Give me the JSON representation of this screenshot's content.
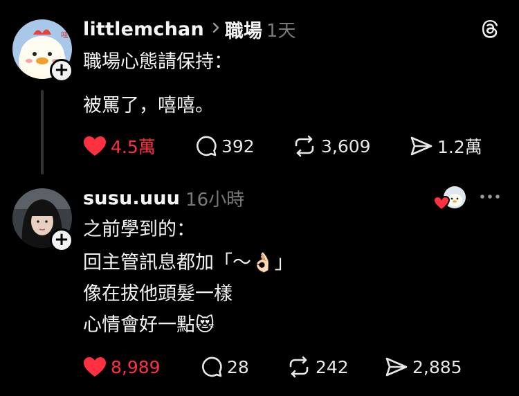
{
  "post": {
    "username": "littlemchan",
    "topic": "職場",
    "time": "1天",
    "lines": [
      "職場心態請保持：",
      "被罵了，嘻嘻。"
    ],
    "actions": {
      "likes": "4.5萬",
      "comments": "392",
      "reposts": "3,609",
      "shares": "1.2萬"
    }
  },
  "reply": {
    "username": "susu.uuu",
    "time": "16小時",
    "lines": [
      "之前學到的：",
      "回主管訊息都加「～👌🏻」",
      "像在拔他頭髮一樣",
      "心情會好一點😻"
    ],
    "actions": {
      "likes": "8,989",
      "comments": "28",
      "reposts": "242",
      "shares": "2,885"
    }
  },
  "icons": {
    "app_logo": "threads-logo-icon",
    "more": "more-icon",
    "separator": "chevron-right-icon"
  },
  "colors": {
    "background": "#000000",
    "like": "#ff3040",
    "muted": "#7a7a7a"
  }
}
